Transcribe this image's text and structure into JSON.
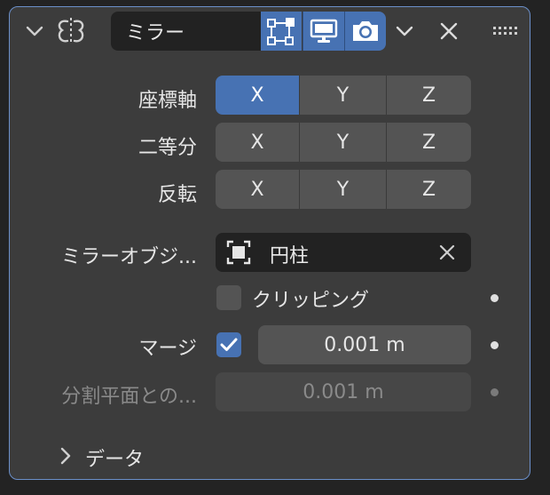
{
  "modifier": {
    "name": "ミラー",
    "colors": {
      "accent": "#4772b3",
      "border": "#6b8fc9",
      "panel": "#3c3c3c",
      "field": "#545454",
      "dark_field": "#222222"
    },
    "icons": {
      "collapse": "chevron-down-icon",
      "type": "mirror-modifier-icon",
      "edit_mode": "edit-mode-vertices-icon",
      "viewport": "monitor-icon",
      "render": "camera-icon",
      "dropdown": "chevron-down-icon",
      "remove": "close-icon",
      "drag": "drag-handle-icon"
    }
  },
  "axis_rows": [
    {
      "label": "座標軸",
      "buttons": [
        "X",
        "Y",
        "Z"
      ],
      "active": [
        true,
        false,
        false
      ]
    },
    {
      "label": "二等分",
      "buttons": [
        "X",
        "Y",
        "Z"
      ],
      "active": [
        false,
        false,
        false
      ]
    },
    {
      "label": "反転",
      "buttons": [
        "X",
        "Y",
        "Z"
      ],
      "active": [
        false,
        false,
        false
      ]
    }
  ],
  "mirror_object": {
    "label": "ミラーオブジ...",
    "value": "円柱",
    "icon": "object-icon"
  },
  "clipping": {
    "label": "クリッピング",
    "checked": false
  },
  "merge": {
    "label": "マージ",
    "checked": true,
    "value": "0.001 m"
  },
  "bisect_distance": {
    "label": "分割平面との...",
    "value": "0.001 m"
  },
  "data_section": {
    "label": "データ",
    "expanded": false
  }
}
